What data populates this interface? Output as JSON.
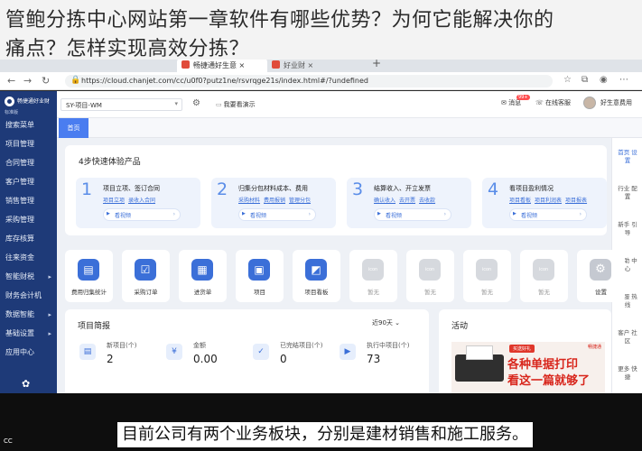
{
  "overlay": {
    "line1": "管鲍分拣中心网站第一章软件有哪些优势？为何它能解决你的",
    "line2": "痛点？怎样实现高效分拣？"
  },
  "browser": {
    "tabs": [
      {
        "label": "畅捷通好生意 ×"
      },
      {
        "label": "好业财 ×"
      }
    ],
    "new_tab": "+",
    "url": "https://cloud.chanjet.com/cc/u0f0?putz1ne/rsvrqge21s/index.html#/?undefined",
    "nav_back": "←",
    "nav_forward": "→",
    "nav_reload": "↻"
  },
  "sidebar": {
    "logo_name": "畅捷通好业财",
    "logo_sub": "标准版",
    "items": [
      {
        "label": "搜索菜单",
        "arrow": ""
      },
      {
        "label": "项目管理",
        "arrow": ""
      },
      {
        "label": "合同管理",
        "arrow": ""
      },
      {
        "label": "客户管理",
        "arrow": ""
      },
      {
        "label": "销售管理",
        "arrow": ""
      },
      {
        "label": "采购管理",
        "arrow": ""
      },
      {
        "label": "库存核算",
        "arrow": ""
      },
      {
        "label": "往来资金",
        "arrow": ""
      },
      {
        "label": "智能财税",
        "arrow": "▸"
      },
      {
        "label": "财务会计机",
        "arrow": ""
      },
      {
        "label": "数据智能",
        "arrow": "▸"
      },
      {
        "label": "基础设置",
        "arrow": "▸"
      },
      {
        "label": "应用中心",
        "arrow": ""
      }
    ],
    "gear": "✿"
  },
  "topbar": {
    "project": "SY-项目-WM",
    "dropdown": "▾",
    "gear": "⚙",
    "demo_link": "我要看演示",
    "messages": "消息",
    "messages_badge": "99+",
    "online_service": "在线客服",
    "user": "好生意费用"
  },
  "crumb": {
    "home": "首页"
  },
  "rightbar": [
    {
      "label": "首页 设置",
      "active": true
    },
    {
      "label": "行业 配置",
      "active": false
    },
    {
      "label": "新手 引导",
      "active": false
    },
    {
      "label": "帮助 中心",
      "active": false
    },
    {
      "label": "客服 热线",
      "active": false
    },
    {
      "label": "客户 社区",
      "active": false
    },
    {
      "label": "更多 快捷",
      "active": false
    }
  ],
  "quick_start": {
    "title": "4步快速体验产品",
    "steps": [
      {
        "num": "1",
        "title": "项目立项、签订合同",
        "links": [
          "项目立项",
          "录收入合同"
        ],
        "video": "看视频"
      },
      {
        "num": "2",
        "title": "归集分包材料成本、费用",
        "links": [
          "采购材料",
          "费用报销",
          "管理分包"
        ],
        "video": "看视频"
      },
      {
        "num": "3",
        "title": "结算收入、开立发票",
        "links": [
          "确认收入",
          "去开票",
          "去收款"
        ],
        "video": "看视频"
      },
      {
        "num": "4",
        "title": "看项目盈利情况",
        "links": [
          "项目看板",
          "项目利润表",
          "项目报表"
        ],
        "video": "看视频"
      }
    ]
  },
  "shortcuts": [
    {
      "label": "费用归集统计",
      "icon": "▤",
      "active": true
    },
    {
      "label": "采购订单",
      "icon": "☑",
      "active": true
    },
    {
      "label": "进货单",
      "icon": "▦",
      "active": true
    },
    {
      "label": "项目",
      "icon": "▣",
      "active": true
    },
    {
      "label": "项目看板",
      "icon": "◩",
      "active": true
    },
    {
      "label": "暂无",
      "icon": "icon",
      "active": false
    },
    {
      "label": "暂无",
      "icon": "icon",
      "active": false
    },
    {
      "label": "暂无",
      "icon": "icon",
      "active": false
    },
    {
      "label": "暂无",
      "icon": "icon",
      "active": false
    },
    {
      "label": "设置",
      "icon": "⚙",
      "active": false
    }
  ],
  "project_overview": {
    "title": "项目简报",
    "period": "近90天 ⌄",
    "stats": [
      {
        "label": "新项目(个)",
        "value": "2",
        "icon": "▤"
      },
      {
        "label": "金额",
        "value": "0.00",
        "icon": "¥"
      },
      {
        "label": "已完结项目(个)",
        "value": "0",
        "icon": "✓"
      },
      {
        "label": "执行中项目(个)",
        "value": "73",
        "icon": "▶"
      }
    ]
  },
  "activity": {
    "title": "活动",
    "promo_tag": "买送好礼",
    "promo_brand": "畅捷通",
    "promo_line1": "各种单据打印",
    "promo_line2": "看这一篇就够了"
  },
  "subtitle": "目前公司有两个业务板块，分别是建材销售和施工服务。",
  "cc": "CC"
}
